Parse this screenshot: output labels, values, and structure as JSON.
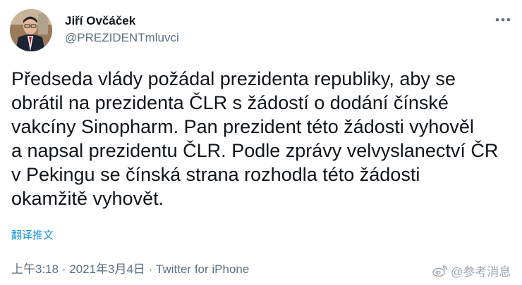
{
  "author": {
    "name": "Jiří Ovčáček",
    "handle": "@PREZIDENTmluvci",
    "avatar": "avatar"
  },
  "more_icon": "more-options-icon",
  "tweet": {
    "lines": [
      "Předseda vlády požádal prezidenta republiky, aby se",
      "obrátil na prezidenta ČLR s žádostí o dodání čínské",
      "vakcíny Sinopharm. Pan prezident této žádosti vyhověl",
      "a napsal prezidentu ČLR. Podle zprávy velvyslanectví ČR",
      "v Pekingu se čínská strana rozhodla této žádosti",
      "okamžitě vyhovět."
    ],
    "translate_label": "翻译推文",
    "meta": "上午3:18 · 2021年3月4日 · Twitter for iPhone"
  },
  "watermark": {
    "icon": "weibo-icon",
    "text": "@参考消息"
  },
  "colors": {
    "text": "#0f1419",
    "secondary": "#5b7083",
    "link": "#1b95e0",
    "watermark": "#9aa4ad"
  }
}
